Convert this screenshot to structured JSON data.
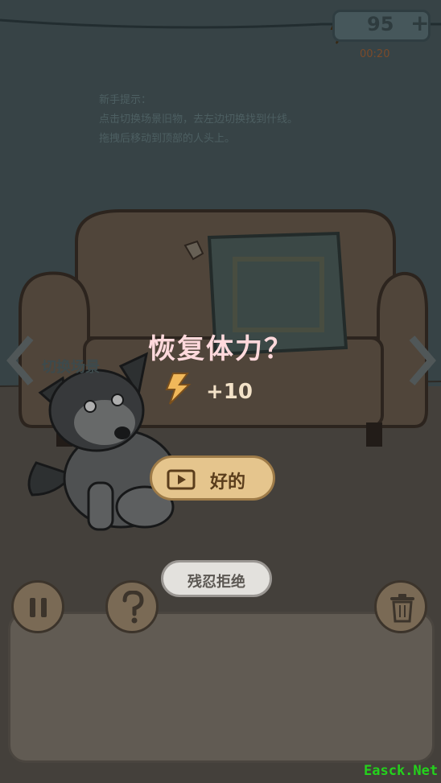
{
  "hud": {
    "energy_value": "95",
    "energy_plus": "+",
    "timer": "00:20",
    "icons": {
      "energy": "lightning-bolt-icon",
      "add": "plus-icon"
    }
  },
  "tip": {
    "title": "新手提示：",
    "line1": "点击切换场景旧物，去左边切换找到什线。",
    "line2": "拖拽后移动到顶部的人头上。"
  },
  "scene": {
    "label": "切换场景",
    "nav_icons": {
      "prev": "chevron-left-icon",
      "next": "chevron-right-icon"
    }
  },
  "dialog": {
    "title": "恢复体力？",
    "reward_text": "+10",
    "reward_icon": "lightning-bolt-icon",
    "ok_label": "好的",
    "ok_icon": "play-video-icon",
    "refuse_label": "残忍拒绝"
  },
  "toolbar": {
    "pause_icon": "pause-icon",
    "help_icon": "question-mark-icon",
    "trash_icon": "trash-icon"
  },
  "watermark": "Easck.Net",
  "colors": {
    "overlay": "#000000",
    "accent": "#e5c58d",
    "title": "#ffd9dc",
    "watermark": "#24d21c"
  }
}
